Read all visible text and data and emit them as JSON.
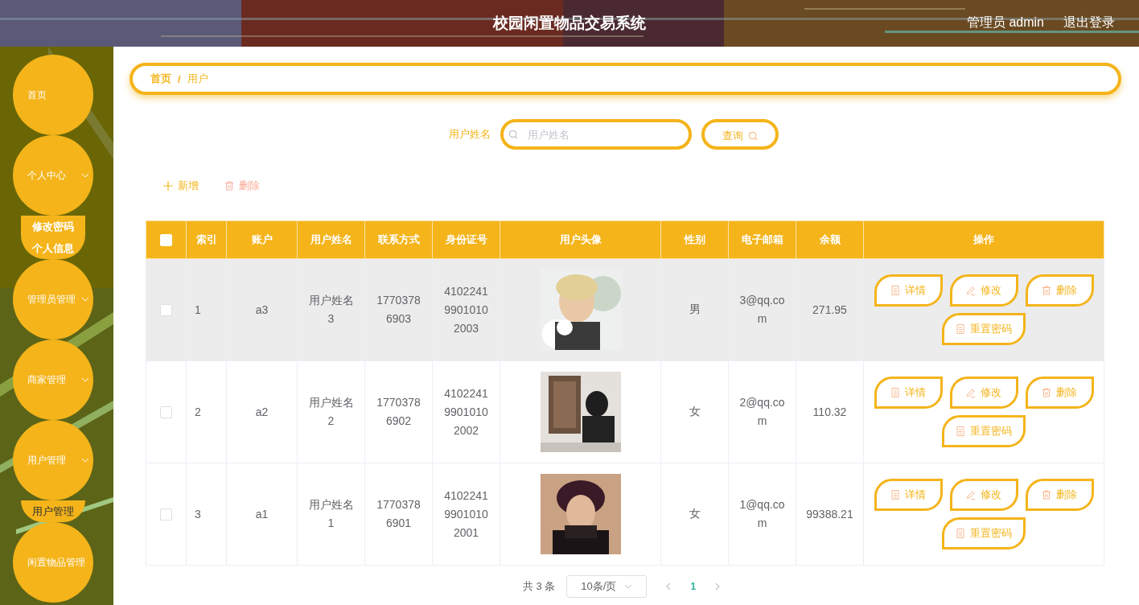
{
  "header": {
    "title": "校园闲置物品交易系统",
    "user": "管理员 admin",
    "logout": "退出登录"
  },
  "sidebar": {
    "items": [
      {
        "label": "首页"
      },
      {
        "label": "个人中心",
        "has_submenu": true,
        "children": [
          {
            "label": "修改密码",
            "selected": false
          },
          {
            "label": "个人信息",
            "selected": false
          }
        ]
      },
      {
        "label": "管理员管理",
        "has_submenu": true
      },
      {
        "label": "商家管理",
        "has_submenu": true
      },
      {
        "label": "用户管理",
        "has_submenu": true,
        "children": [
          {
            "label": "用户管理",
            "selected": true
          }
        ]
      },
      {
        "label": "闲置物品管理",
        "has_submenu": false
      }
    ]
  },
  "breadcrumb": {
    "items": [
      "首页",
      "用户"
    ],
    "separator": "/"
  },
  "search": {
    "label": "用户姓名",
    "placeholder": "用户姓名",
    "button": "查询"
  },
  "actions": [
    {
      "kind": "add",
      "label": "新增"
    },
    {
      "kind": "delete",
      "label": "删除"
    }
  ],
  "table": {
    "select_all": {
      "checked": false
    },
    "columns": [
      "索引",
      "账户",
      "用户姓名",
      "联系方式",
      "身份证号",
      "用户头像",
      "性别",
      "电子邮箱",
      "余额",
      "操作"
    ],
    "rows": [
      {
        "checked": false,
        "highlighted": true,
        "index": "1",
        "account": "a3",
        "name": "用户姓名3",
        "phone": "17703786903",
        "id_number": "410224199010102003",
        "gender": "男",
        "email": "3@qq.com",
        "balance": "271.95",
        "actions": [
          {
            "kind": "detail",
            "label": "详情"
          },
          {
            "kind": "edit",
            "label": "修改"
          },
          {
            "kind": "delete",
            "label": "删除"
          },
          {
            "kind": "reset",
            "label": "重置密码"
          }
        ]
      },
      {
        "checked": false,
        "highlighted": false,
        "index": "2",
        "account": "a2",
        "name": "用户姓名2",
        "phone": "17703786902",
        "id_number": "410224199010102002",
        "gender": "女",
        "email": "2@qq.com",
        "balance": "110.32",
        "actions": [
          {
            "kind": "detail",
            "label": "详情"
          },
          {
            "kind": "edit",
            "label": "修改"
          },
          {
            "kind": "delete",
            "label": "删除"
          },
          {
            "kind": "reset",
            "label": "重置密码"
          }
        ]
      },
      {
        "checked": false,
        "highlighted": false,
        "index": "3",
        "account": "a1",
        "name": "用户姓名1",
        "phone": "17703786901",
        "id_number": "410224199010102001",
        "gender": "女",
        "email": "1@qq.com",
        "balance": "99388.21",
        "actions": [
          {
            "kind": "detail",
            "label": "详情"
          },
          {
            "kind": "edit",
            "label": "修改"
          },
          {
            "kind": "delete",
            "label": "删除"
          },
          {
            "kind": "reset",
            "label": "重置密码"
          }
        ]
      }
    ]
  },
  "pagination": {
    "total": "共 3 条",
    "page_size": "10条/页",
    "pages": [
      {
        "label": "1",
        "selected": true
      }
    ]
  }
}
